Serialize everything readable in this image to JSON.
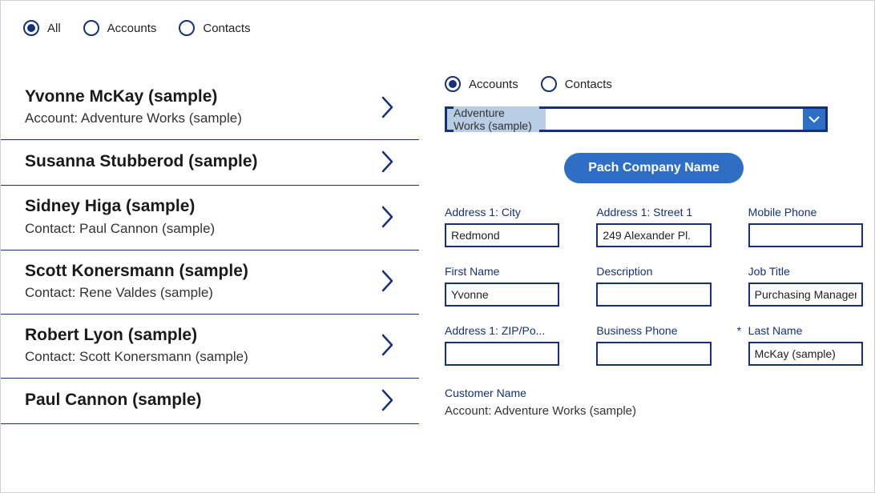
{
  "topFilters": {
    "options": [
      {
        "key": "all",
        "label": "All",
        "selected": true
      },
      {
        "key": "accounts",
        "label": "Accounts",
        "selected": false
      },
      {
        "key": "contacts",
        "label": "Contacts",
        "selected": false
      }
    ]
  },
  "list": [
    {
      "name": "Yvonne McKay (sample)",
      "sub": "Account: Adventure Works (sample)"
    },
    {
      "name": "Susanna Stubberod (sample)",
      "sub": ""
    },
    {
      "name": "Sidney Higa (sample)",
      "sub": "Contact: Paul Cannon (sample)"
    },
    {
      "name": "Scott Konersmann (sample)",
      "sub": "Contact: Rene Valdes (sample)"
    },
    {
      "name": "Robert Lyon (sample)",
      "sub": "Contact: Scott Konersmann (sample)"
    },
    {
      "name": "Paul Cannon (sample)",
      "sub": ""
    }
  ],
  "rightFilters": {
    "options": [
      {
        "key": "accounts",
        "label": "Accounts",
        "selected": true
      },
      {
        "key": "contacts",
        "label": "Contacts",
        "selected": false
      }
    ]
  },
  "accountSelect": {
    "value": "Adventure Works (sample)"
  },
  "actionButton": {
    "label": "Pach Company Name"
  },
  "fields": [
    {
      "key": "city",
      "label": "Address 1: City",
      "value": "Redmond",
      "required": false
    },
    {
      "key": "street1",
      "label": "Address 1: Street 1",
      "value": "249 Alexander Pl.",
      "required": false
    },
    {
      "key": "mobile",
      "label": "Mobile Phone",
      "value": "",
      "required": false
    },
    {
      "key": "firstname",
      "label": "First Name",
      "value": "Yvonne",
      "required": false
    },
    {
      "key": "description",
      "label": "Description",
      "value": "",
      "required": false
    },
    {
      "key": "jobtitle",
      "label": "Job Title",
      "value": "Purchasing Manager",
      "required": false
    },
    {
      "key": "zip",
      "label": "Address 1: ZIP/Po...",
      "value": "",
      "required": false
    },
    {
      "key": "busphone",
      "label": "Business Phone",
      "value": "",
      "required": false
    },
    {
      "key": "lastname",
      "label": "Last Name",
      "value": "McKay (sample)",
      "required": true
    }
  ],
  "customer": {
    "label": "Customer Name",
    "value": "Account: Adventure Works (sample)"
  }
}
